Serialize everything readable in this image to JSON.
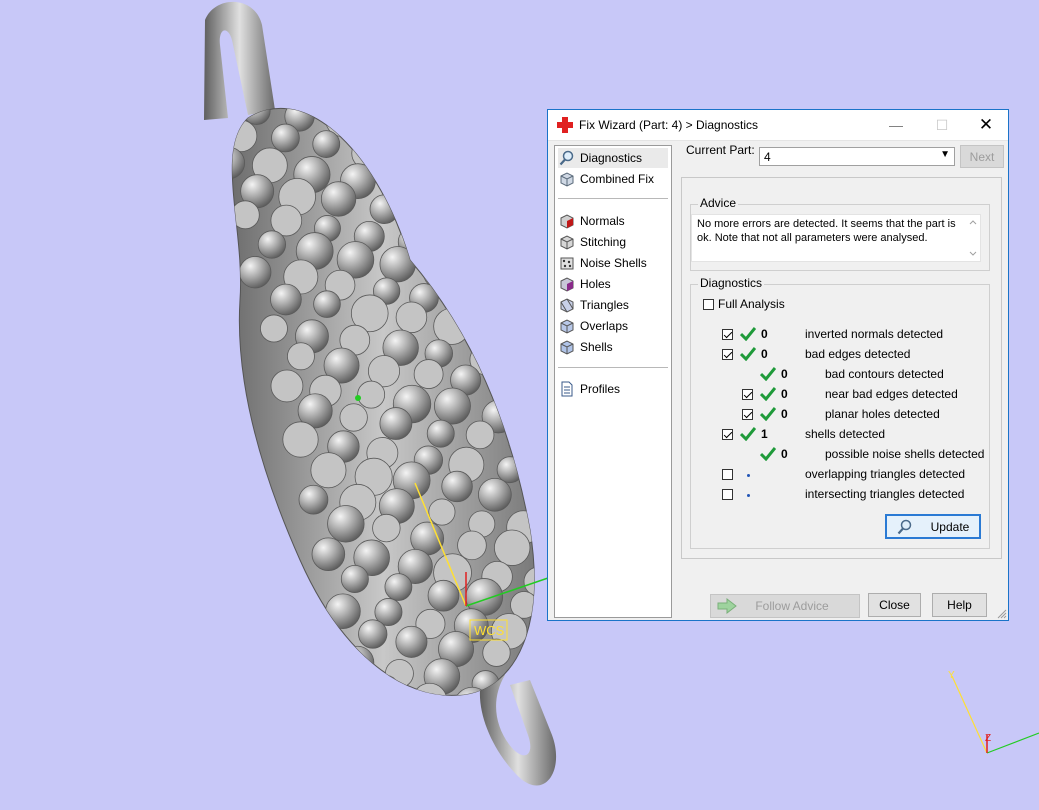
{
  "window": {
    "title": "Fix Wizard (Part: 4) > Diagnostics",
    "controls": {
      "minimize": "—",
      "maximize": "☐",
      "close": "✕"
    }
  },
  "nav": {
    "top": [
      {
        "label": "Diagnostics",
        "icon": "magnifier-icon",
        "selected": true
      },
      {
        "label": "Combined Fix",
        "icon": "cube-icon"
      }
    ],
    "tools": [
      {
        "label": "Normals",
        "icon": "normals-cube-icon"
      },
      {
        "label": "Stitching",
        "icon": "stitching-cube-icon"
      },
      {
        "label": "Noise Shells",
        "icon": "noise-shells-icon"
      },
      {
        "label": "Holes",
        "icon": "holes-cube-icon"
      },
      {
        "label": "Triangles",
        "icon": "triangles-cube-icon"
      },
      {
        "label": "Overlaps",
        "icon": "overlaps-cube-icon"
      },
      {
        "label": "Shells",
        "icon": "shells-cube-icon"
      }
    ],
    "bottom": [
      {
        "label": "Profiles",
        "icon": "document-icon"
      }
    ]
  },
  "current_part": {
    "label": "Current Part:",
    "value": "4",
    "next": "Next"
  },
  "advice": {
    "title": "Advice",
    "text": "No more errors are detected. It seems that the part is ok. Note that not all parameters were analysed."
  },
  "diagnostics": {
    "title": "Diagnostics",
    "full_analysis": {
      "label": "Full Analysis",
      "checked": false
    },
    "rows": [
      {
        "checkbox": true,
        "checked": true,
        "status": "ok",
        "count": "0",
        "label": "inverted normals detected",
        "indent": 0
      },
      {
        "checkbox": true,
        "checked": true,
        "status": "ok",
        "count": "0",
        "label": "bad edges detected",
        "indent": 0
      },
      {
        "checkbox": false,
        "checked": false,
        "status": "ok",
        "count": "0",
        "label": "bad contours detected",
        "indent": 1
      },
      {
        "checkbox": true,
        "checked": true,
        "status": "ok",
        "count": "0",
        "label": "near bad edges detected",
        "indent": 1
      },
      {
        "checkbox": true,
        "checked": true,
        "status": "ok",
        "count": "0",
        "label": "planar holes detected",
        "indent": 1
      },
      {
        "checkbox": true,
        "checked": true,
        "status": "ok",
        "count": "1",
        "label": "shells detected",
        "indent": 0
      },
      {
        "checkbox": false,
        "checked": false,
        "status": "ok",
        "count": "0",
        "label": "possible noise shells detected",
        "indent": 1
      },
      {
        "checkbox": true,
        "checked": false,
        "status": "none",
        "count": "",
        "label": "overlapping triangles detected",
        "indent": 0
      },
      {
        "checkbox": true,
        "checked": false,
        "status": "none",
        "count": "",
        "label": "intersecting triangles detected",
        "indent": 0
      }
    ],
    "update": "Update"
  },
  "buttons": {
    "follow_advice": "Follow Advice",
    "close": "Close",
    "help": "Help"
  },
  "scene": {
    "wcs_label": "WCS",
    "axes": {
      "x": "X",
      "y": "Y",
      "z": "Z"
    },
    "colors": {
      "background": "#c8c8f8",
      "model": "#9a9a9a",
      "y_axis": "#ffe033",
      "x_axis": "#22cc22",
      "z_axis": "#e02020"
    }
  }
}
